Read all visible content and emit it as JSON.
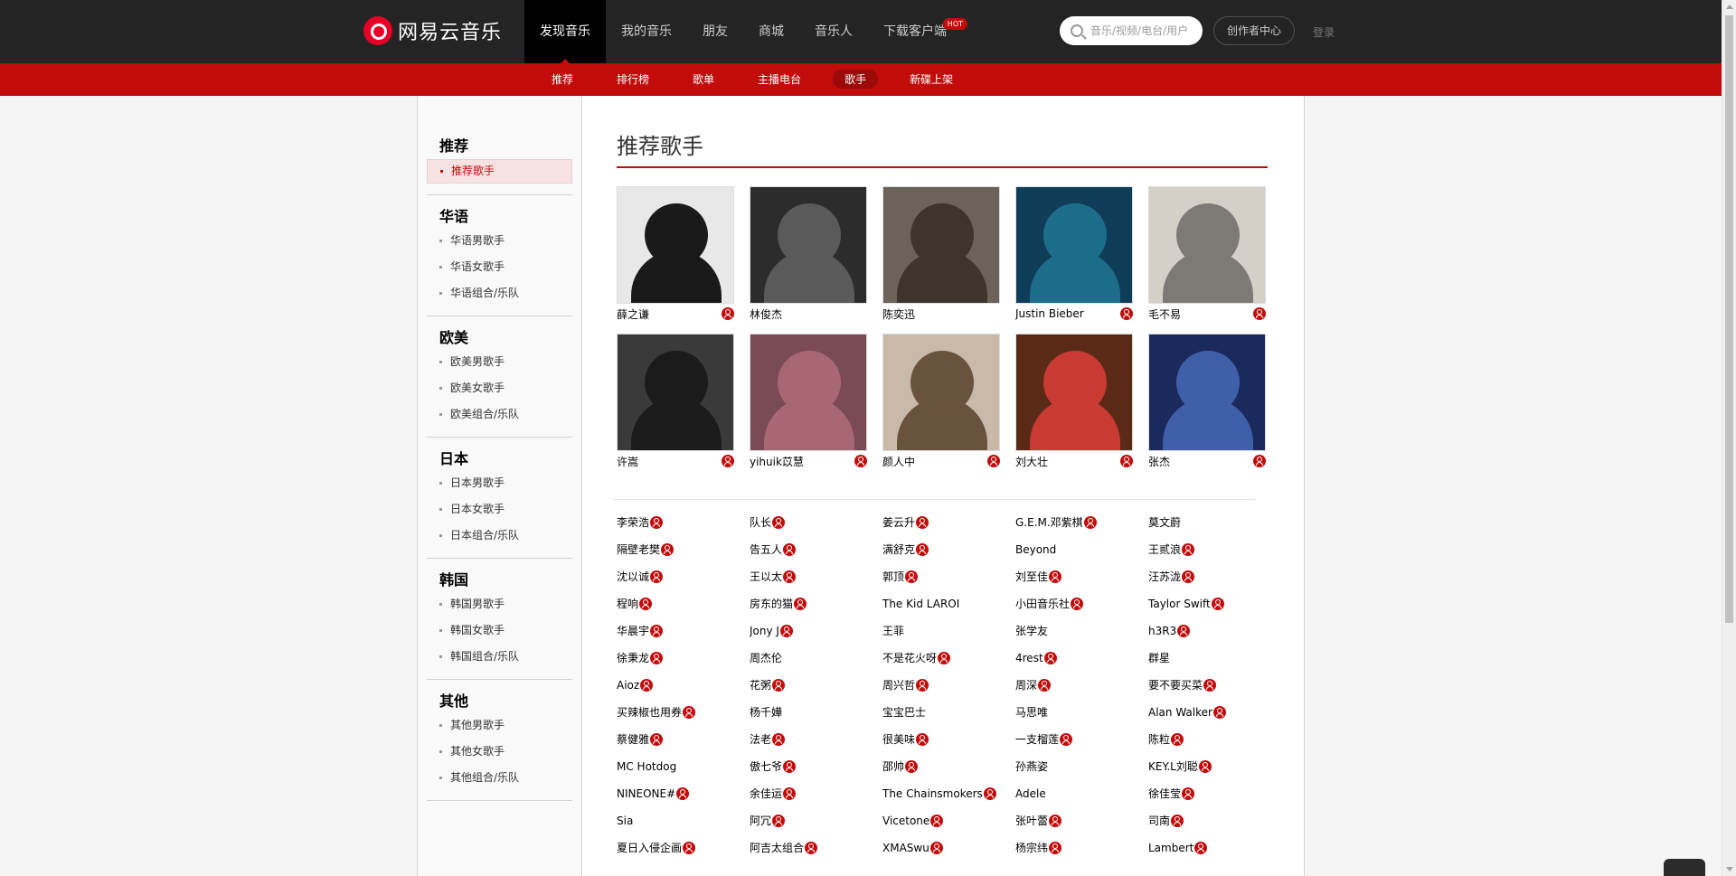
{
  "header": {
    "logo_text": "网易云音乐",
    "nav": [
      {
        "label": "发现音乐",
        "active": true
      },
      {
        "label": "我的音乐"
      },
      {
        "label": "朋友"
      },
      {
        "label": "商城"
      },
      {
        "label": "音乐人"
      },
      {
        "label": "下载客户端",
        "badge": "HOT"
      }
    ],
    "search_placeholder": "音乐/视频/电台/用户",
    "creator_center": "创作者中心",
    "login": "登录"
  },
  "subnav": [
    "推荐",
    "排行榜",
    "歌单",
    "主播电台",
    "歌手",
    "新碟上架"
  ],
  "subnav_active": "歌手",
  "sidebar": [
    {
      "title": "推荐",
      "items": [
        "推荐歌手"
      ],
      "active_item": "推荐歌手"
    },
    {
      "title": "华语",
      "items": [
        "华语男歌手",
        "华语女歌手",
        "华语组合/乐队"
      ]
    },
    {
      "title": "欧美",
      "items": [
        "欧美男歌手",
        "欧美女歌手",
        "欧美组合/乐队"
      ]
    },
    {
      "title": "日本",
      "items": [
        "日本男歌手",
        "日本女歌手",
        "日本组合/乐队"
      ]
    },
    {
      "title": "韩国",
      "items": [
        "韩国男歌手",
        "韩国女歌手",
        "韩国组合/乐队"
      ]
    },
    {
      "title": "其他",
      "items": [
        "其他男歌手",
        "其他女歌手",
        "其他组合/乐队"
      ]
    }
  ],
  "main": {
    "title": "推荐歌手",
    "top_artists": [
      {
        "name": "薛之谦",
        "has_profile": true,
        "bg": "#e8e8e8",
        "fg": "#1a1a1a"
      },
      {
        "name": "林俊杰",
        "has_profile": false,
        "bg": "#2c2c2c",
        "fg": "#5a5a5a"
      },
      {
        "name": "陈奕迅",
        "has_profile": false,
        "bg": "#6b6259",
        "fg": "#3d352d"
      },
      {
        "name": "Justin Bieber",
        "has_profile": true,
        "bg": "#0f3d57",
        "fg": "#1d6c8a"
      },
      {
        "name": "毛不易",
        "has_profile": true,
        "bg": "#d4d0c8",
        "fg": "#7d7a75"
      },
      {
        "name": "许嵩",
        "has_profile": true,
        "bg": "#3a3a3a",
        "fg": "#1b1b1b"
      },
      {
        "name": "yihuik苡慧",
        "has_profile": true,
        "bg": "#7a4a55",
        "fg": "#a86873"
      },
      {
        "name": "颜人中",
        "has_profile": true,
        "bg": "#c8b9a9",
        "fg": "#6a533e"
      },
      {
        "name": "刘大壮",
        "has_profile": true,
        "bg": "#5a2a17",
        "fg": "#c93a33"
      },
      {
        "name": "张杰",
        "has_profile": true,
        "bg": "#1b2a5c",
        "fg": "#3f5fa8"
      }
    ],
    "artist_names": [
      {
        "name": "李荣浩",
        "p": true
      },
      {
        "name": "队长",
        "p": true
      },
      {
        "name": "姜云升",
        "p": true
      },
      {
        "name": "G.E.M.邓紫棋",
        "p": true
      },
      {
        "name": "莫文蔚",
        "p": false
      },
      {
        "name": "隔壁老樊",
        "p": true
      },
      {
        "name": "告五人",
        "p": true
      },
      {
        "name": "满舒克",
        "p": true
      },
      {
        "name": "Beyond",
        "p": false
      },
      {
        "name": "王贰浪",
        "p": true
      },
      {
        "name": "沈以诚",
        "p": true
      },
      {
        "name": "王以太",
        "p": true
      },
      {
        "name": "郭顶",
        "p": true
      },
      {
        "name": "刘至佳",
        "p": true
      },
      {
        "name": "汪苏泷",
        "p": true
      },
      {
        "name": "程响",
        "p": true
      },
      {
        "name": "房东的猫",
        "p": true
      },
      {
        "name": "The Kid LAROI",
        "p": false
      },
      {
        "name": "小田音乐社",
        "p": true
      },
      {
        "name": "Taylor Swift",
        "p": true
      },
      {
        "name": "华晨宇",
        "p": true
      },
      {
        "name": "Jony J",
        "p": true
      },
      {
        "name": "王菲",
        "p": false
      },
      {
        "name": "张学友",
        "p": false
      },
      {
        "name": "h3R3",
        "p": true
      },
      {
        "name": "徐秉龙",
        "p": true
      },
      {
        "name": "周杰伦",
        "p": false
      },
      {
        "name": "不是花火呀",
        "p": true
      },
      {
        "name": "4rest",
        "p": true
      },
      {
        "name": "群星",
        "p": false
      },
      {
        "name": "Aioz",
        "p": true
      },
      {
        "name": "花粥",
        "p": true
      },
      {
        "name": "周兴哲",
        "p": true
      },
      {
        "name": "周深",
        "p": true
      },
      {
        "name": "要不要买菜",
        "p": true
      },
      {
        "name": "买辣椒也用券",
        "p": true
      },
      {
        "name": "杨千嬅",
        "p": false
      },
      {
        "name": "宝宝巴士",
        "p": false
      },
      {
        "name": "马思唯",
        "p": false
      },
      {
        "name": "Alan Walker",
        "p": true
      },
      {
        "name": "蔡健雅",
        "p": true
      },
      {
        "name": "法老",
        "p": true
      },
      {
        "name": "很美味",
        "p": true
      },
      {
        "name": "一支榴莲",
        "p": true
      },
      {
        "name": "陈粒",
        "p": true
      },
      {
        "name": "MC Hotdog",
        "p": false
      },
      {
        "name": "傲七爷",
        "p": true
      },
      {
        "name": "邵帅",
        "p": true
      },
      {
        "name": "孙燕姿",
        "p": false
      },
      {
        "name": "KEY.L刘聪",
        "p": true
      },
      {
        "name": "NINEONE#",
        "p": true
      },
      {
        "name": "余佳运",
        "p": true
      },
      {
        "name": "The Chainsmokers",
        "p": true
      },
      {
        "name": "Adele",
        "p": false
      },
      {
        "name": "徐佳莹",
        "p": true
      },
      {
        "name": "Sia",
        "p": false
      },
      {
        "name": "阿冗",
        "p": true
      },
      {
        "name": "Vicetone",
        "p": true
      },
      {
        "name": "张叶蕾",
        "p": true
      },
      {
        "name": "司南",
        "p": true
      },
      {
        "name": "夏日入侵企画",
        "p": true
      },
      {
        "name": "阿吉太组合",
        "p": true
      },
      {
        "name": "XMASwu",
        "p": true
      },
      {
        "name": "杨宗纬",
        "p": true
      },
      {
        "name": "Lambert",
        "p": true
      }
    ]
  }
}
